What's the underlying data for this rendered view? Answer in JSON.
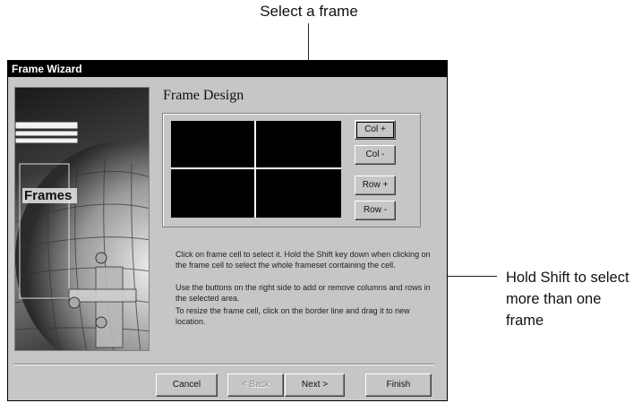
{
  "callouts": {
    "top": "Select a frame",
    "right_line1": "Hold Shift to select",
    "right_line2": "more than one frame"
  },
  "window": {
    "title": "Frame Wizard",
    "art_label": "Frames",
    "section_heading": "Frame Design"
  },
  "side_buttons": [
    "Col +",
    "Col -",
    "Row +",
    "Row -"
  ],
  "help": [
    "Click on frame cell to select it. Hold the Shift key down when clicking on the frame cell to select the whole frameset containing the cell.",
    "Use the buttons on the right side to add or remove columns and rows in the selected area.",
    "To resize the frame cell, click on the border line and drag it to new location."
  ],
  "bottom_buttons": {
    "cancel": "Cancel",
    "back": "< Back",
    "next": "Next >",
    "finish": "Finish"
  }
}
